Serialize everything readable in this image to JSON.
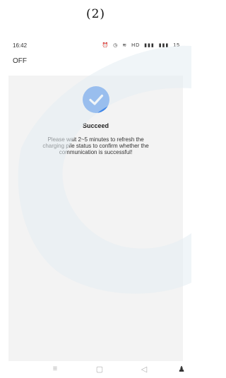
{
  "caption": "(2)",
  "status_bar": {
    "time": "16:42",
    "icons": [
      "alarm-icon",
      "clock-icon",
      "wifi-icon",
      "hd-icon",
      "signal-icon",
      "signal-icon",
      "battery-icon"
    ],
    "hd_text": "HD",
    "battery_text": "15"
  },
  "app_bar": {
    "off_label": "OFF"
  },
  "result": {
    "title": "Succeed",
    "message": "Please wait 2~5 minutes to refresh the charging pile status to confirm whether the communication is successful!",
    "icon": "check-circle-icon",
    "accent": "#3f86e8"
  },
  "nav_bar": {
    "buttons": [
      "menu-icon",
      "home-icon",
      "back-icon",
      "accessibility-icon"
    ]
  }
}
